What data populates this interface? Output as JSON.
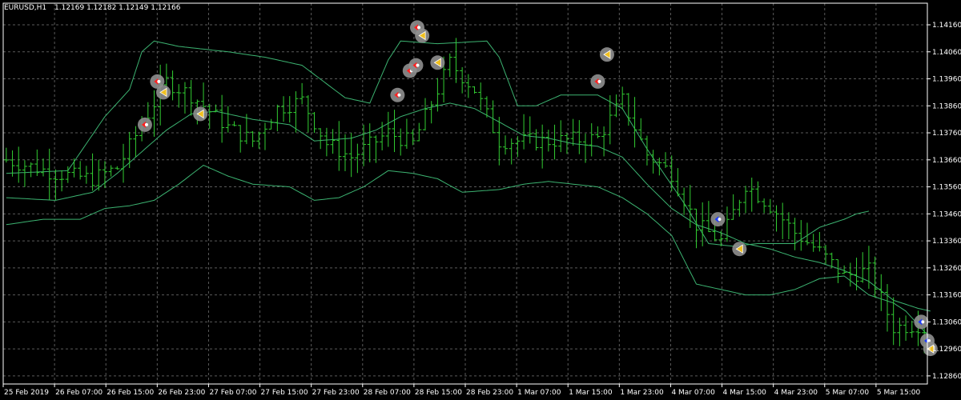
{
  "header": {
    "symbol_timeframe": "EURUSD,H1",
    "ohlc": "1.12169 1.12182 1.12149 1.12166"
  },
  "colors": {
    "background": "#000000",
    "grid": "#5a5a5a",
    "candles": "#32cd32",
    "bands": "#3cb371",
    "text": "#ffffff",
    "marker_bg": "#8f8f8f",
    "buy_arrow": "#1e3cff",
    "sell_arrow": "#ff2020",
    "close_arrow": "#f0c020"
  },
  "chart_data": {
    "type": "ohlc",
    "yticks": [
      "1.14160",
      "1.14060",
      "1.13960",
      "1.13860",
      "1.13760",
      "1.13660",
      "1.13560",
      "1.13460",
      "1.13360",
      "1.13260",
      "1.13160",
      "1.13060",
      "1.12960",
      "1.12860"
    ],
    "ylim": [
      1.1283,
      1.1424
    ],
    "xticks": [
      "25 Feb 2019",
      "26 Feb 07:00",
      "26 Feb 15:00",
      "26 Feb 23:00",
      "27 Feb 07:00",
      "27 Feb 15:00",
      "27 Feb 23:00",
      "28 Feb 07:00",
      "28 Feb 15:00",
      "28 Feb 23:00",
      "1 Mar 07:00",
      "1 Mar 15:00",
      "1 Mar 23:00",
      "4 Mar 07:00",
      "4 Mar 15:00",
      "4 Mar 23:00",
      "5 Mar 07:00",
      "5 Mar 15:00"
    ],
    "bars": 150,
    "close_path": [
      [
        0,
        1.1366
      ],
      [
        8,
        1.1361
      ],
      [
        14,
        1.1359
      ],
      [
        18,
        1.1363
      ],
      [
        22,
        1.1379
      ],
      [
        26,
        1.1395
      ],
      [
        30,
        1.139
      ],
      [
        36,
        1.1378
      ],
      [
        40,
        1.1373
      ],
      [
        44,
        1.1385
      ],
      [
        48,
        1.1388
      ],
      [
        52,
        1.1372
      ],
      [
        56,
        1.1367
      ],
      [
        62,
        1.1376
      ],
      [
        66,
        1.1372
      ],
      [
        72,
        1.1402
      ],
      [
        76,
        1.1392
      ],
      [
        80,
        1.1373
      ],
      [
        88,
        1.1373
      ],
      [
        96,
        1.1374
      ],
      [
        100,
        1.1388
      ],
      [
        104,
        1.1368
      ],
      [
        108,
        1.1361
      ],
      [
        112,
        1.1342
      ],
      [
        116,
        1.1336
      ],
      [
        120,
        1.1357
      ],
      [
        124,
        1.1349
      ],
      [
        128,
        1.1339
      ],
      [
        132,
        1.1332
      ],
      [
        136,
        1.1323
      ],
      [
        140,
        1.1325
      ],
      [
        144,
        1.1304
      ],
      [
        148,
        1.1305
      ],
      [
        150,
        1.1302
      ]
    ],
    "upper_band": [
      [
        0,
        1.1361
      ],
      [
        10,
        1.1362
      ],
      [
        16,
        1.1382
      ],
      [
        20,
        1.1392
      ],
      [
        22,
        1.1406
      ],
      [
        24,
        1.141
      ],
      [
        28,
        1.1408
      ],
      [
        36,
        1.1406
      ],
      [
        42,
        1.1404
      ],
      [
        48,
        1.1401
      ],
      [
        55,
        1.1389
      ],
      [
        59,
        1.1387
      ],
      [
        62,
        1.1403
      ],
      [
        64,
        1.141
      ],
      [
        70,
        1.1409
      ],
      [
        78,
        1.141
      ],
      [
        80,
        1.1404
      ],
      [
        83,
        1.1386
      ],
      [
        86,
        1.1386
      ],
      [
        90,
        1.139
      ],
      [
        96,
        1.139
      ],
      [
        100,
        1.1385
      ],
      [
        104,
        1.137
      ],
      [
        110,
        1.135
      ],
      [
        114,
        1.1335
      ],
      [
        118,
        1.1334
      ],
      [
        122,
        1.1335
      ],
      [
        128,
        1.1335
      ],
      [
        132,
        1.1341
      ],
      [
        136,
        1.1344
      ],
      [
        138,
        1.1346
      ],
      [
        140,
        1.1347
      ]
    ],
    "middle_band": [
      [
        0,
        1.1352
      ],
      [
        8,
        1.1351
      ],
      [
        14,
        1.1354
      ],
      [
        18,
        1.1361
      ],
      [
        22,
        1.1369
      ],
      [
        26,
        1.1377
      ],
      [
        30,
        1.1383
      ],
      [
        34,
        1.1384
      ],
      [
        40,
        1.1381
      ],
      [
        46,
        1.1379
      ],
      [
        50,
        1.1373
      ],
      [
        56,
        1.1374
      ],
      [
        60,
        1.1377
      ],
      [
        64,
        1.1382
      ],
      [
        68,
        1.1385
      ],
      [
        72,
        1.1387
      ],
      [
        76,
        1.1385
      ],
      [
        80,
        1.138
      ],
      [
        84,
        1.1375
      ],
      [
        88,
        1.1374
      ],
      [
        92,
        1.1372
      ],
      [
        96,
        1.1371
      ],
      [
        100,
        1.1367
      ],
      [
        104,
        1.1357
      ],
      [
        108,
        1.1348
      ],
      [
        112,
        1.1342
      ],
      [
        116,
        1.1339
      ],
      [
        120,
        1.1335
      ],
      [
        124,
        1.1333
      ],
      [
        128,
        1.133
      ],
      [
        132,
        1.1328
      ],
      [
        136,
        1.1325
      ],
      [
        140,
        1.1321
      ],
      [
        144,
        1.1314
      ],
      [
        148,
        1.1311
      ],
      [
        150,
        1.131
      ]
    ],
    "lower_band": [
      [
        0,
        1.1342
      ],
      [
        6,
        1.1344
      ],
      [
        12,
        1.1344
      ],
      [
        16,
        1.1348
      ],
      [
        20,
        1.1349
      ],
      [
        24,
        1.1351
      ],
      [
        28,
        1.1357
      ],
      [
        32,
        1.1364
      ],
      [
        36,
        1.136
      ],
      [
        40,
        1.1357
      ],
      [
        46,
        1.1356
      ],
      [
        50,
        1.1351
      ],
      [
        54,
        1.1352
      ],
      [
        58,
        1.1356
      ],
      [
        62,
        1.1362
      ],
      [
        66,
        1.1361
      ],
      [
        70,
        1.1359
      ],
      [
        74,
        1.1354
      ],
      [
        80,
        1.1355
      ],
      [
        84,
        1.1357
      ],
      [
        88,
        1.1358
      ],
      [
        92,
        1.1357
      ],
      [
        96,
        1.1356
      ],
      [
        100,
        1.1352
      ],
      [
        104,
        1.1346
      ],
      [
        108,
        1.1338
      ],
      [
        112,
        1.132
      ],
      [
        116,
        1.1318
      ],
      [
        120,
        1.1316
      ],
      [
        124,
        1.1316
      ],
      [
        128,
        1.1318
      ],
      [
        132,
        1.1322
      ],
      [
        136,
        1.1323
      ],
      [
        140,
        1.1316
      ],
      [
        144,
        1.1313
      ],
      [
        146,
        1.131
      ],
      [
        148,
        1.1305
      ],
      [
        150,
        1.13
      ]
    ],
    "markers": [
      {
        "bar": 22.5,
        "price": 1.1379,
        "kind": "sell"
      },
      {
        "bar": 24.5,
        "price": 1.1395,
        "kind": "sell"
      },
      {
        "bar": 25.5,
        "price": 1.1391,
        "kind": "close"
      },
      {
        "bar": 31.5,
        "price": 1.1383,
        "kind": "close"
      },
      {
        "bar": 63.5,
        "price": 1.139,
        "kind": "sell"
      },
      {
        "bar": 65.5,
        "price": 1.1399,
        "kind": "sell"
      },
      {
        "bar": 66.5,
        "price": 1.1401,
        "kind": "sell"
      },
      {
        "bar": 66.7,
        "price": 1.1415,
        "kind": "sell"
      },
      {
        "bar": 67.5,
        "price": 1.1412,
        "kind": "close"
      },
      {
        "bar": 70,
        "price": 1.1402,
        "kind": "close"
      },
      {
        "bar": 96,
        "price": 1.1395,
        "kind": "sell"
      },
      {
        "bar": 97.5,
        "price": 1.1405,
        "kind": "close"
      },
      {
        "bar": 115.5,
        "price": 1.1344,
        "kind": "buy"
      },
      {
        "bar": 119,
        "price": 1.1333,
        "kind": "close"
      },
      {
        "bar": 148.5,
        "price": 1.1306,
        "kind": "buy"
      },
      {
        "bar": 149.5,
        "price": 1.1299,
        "kind": "buy"
      },
      {
        "bar": 150,
        "price": 1.1296,
        "kind": "close"
      }
    ]
  }
}
